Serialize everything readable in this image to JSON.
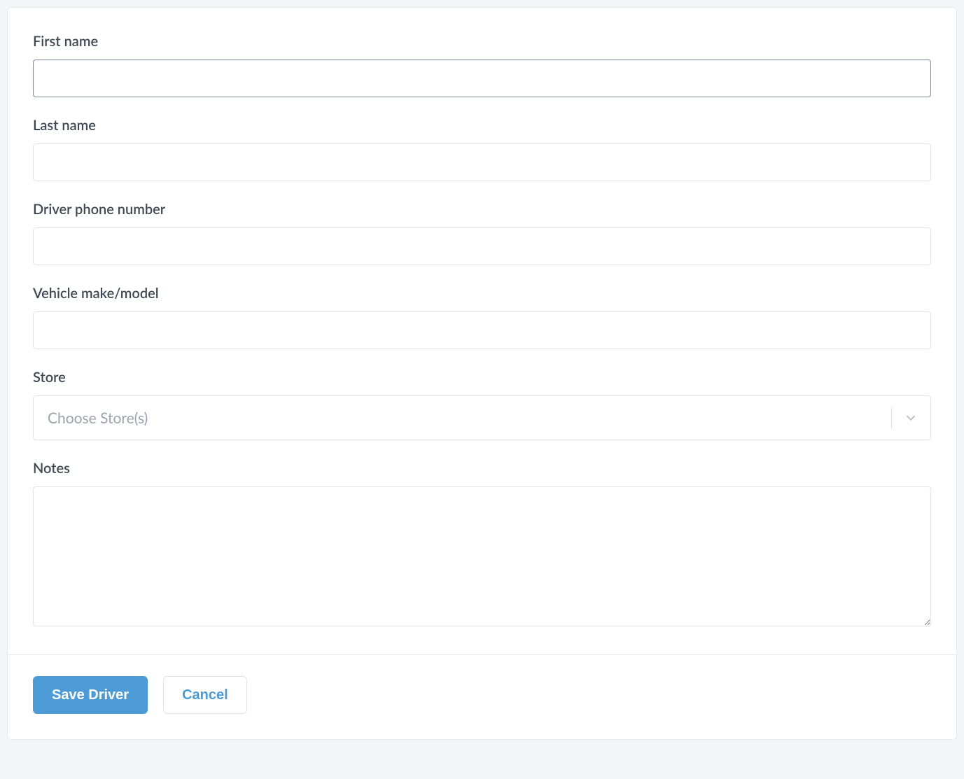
{
  "form": {
    "fields": {
      "first_name": {
        "label": "First name",
        "value": ""
      },
      "last_name": {
        "label": "Last name",
        "value": ""
      },
      "driver_phone": {
        "label": "Driver phone number",
        "value": ""
      },
      "vehicle": {
        "label": "Vehicle make/model",
        "value": ""
      },
      "store": {
        "label": "Store",
        "placeholder": "Choose Store(s)"
      },
      "notes": {
        "label": "Notes",
        "value": ""
      }
    },
    "actions": {
      "save_label": "Save Driver",
      "cancel_label": "Cancel"
    }
  }
}
